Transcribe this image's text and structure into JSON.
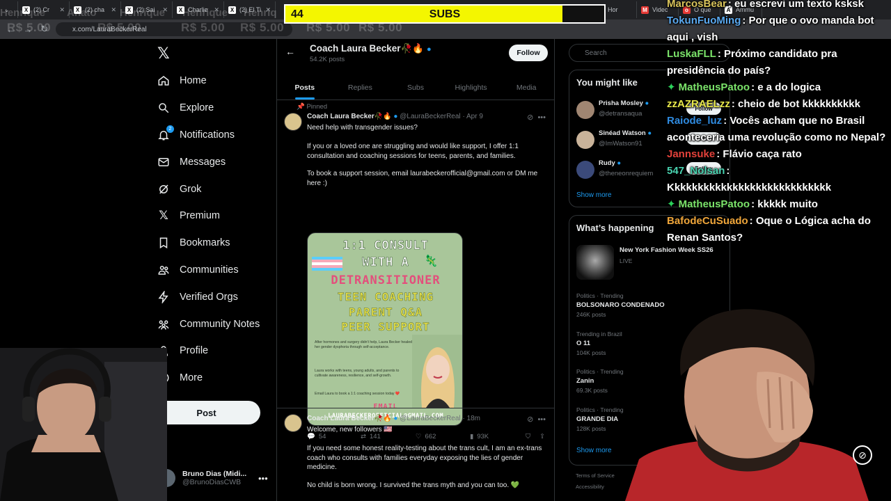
{
  "browser": {
    "tabs": [
      {
        "icon": "X",
        "label": "(2) Cr"
      },
      {
        "icon": "X",
        "label": "(2) cha"
      },
      {
        "icon": "X",
        "label": "(2) Sai"
      },
      {
        "icon": "X",
        "label": "Charlie"
      },
      {
        "icon": "X",
        "label": "(2) El Ti"
      }
    ],
    "tabs_right": [
      {
        "icon": "X",
        "label": "Hor"
      },
      {
        "icon": "M",
        "label": "Videc"
      },
      {
        "icon": "o",
        "label": "O que"
      },
      {
        "icon": "A",
        "label": "Ammu"
      }
    ],
    "url": "x.com/LauraBeckerReal"
  },
  "ghost_text": [
    "R$ 5.00",
    "R$ 5.00",
    "R$ 5.00",
    "R$ 5.00",
    "R$ 5.00",
    "R$ 5.00"
  ],
  "ghost_top": [
    "Henrique",
    "Anato",
    "Henrique",
    "Henrique",
    "Henriq"
  ],
  "subs_goal": {
    "count": "44",
    "label": "SUBS",
    "fill_fraction": 0.87
  },
  "sidebar": {
    "items": [
      {
        "label": "Home",
        "icon": "home-icon"
      },
      {
        "label": "Explore",
        "icon": "search-icon"
      },
      {
        "label": "Notifications",
        "icon": "bell-icon",
        "badge": "2"
      },
      {
        "label": "Messages",
        "icon": "mail-icon"
      },
      {
        "label": "Grok",
        "icon": "grok-icon"
      },
      {
        "label": "Premium",
        "icon": "x-icon"
      },
      {
        "label": "Bookmarks",
        "icon": "bookmark-icon"
      },
      {
        "label": "Communities",
        "icon": "people-icon"
      },
      {
        "label": "Verified Orgs",
        "icon": "bolt-icon"
      },
      {
        "label": "Community Notes",
        "icon": "notes-icon"
      },
      {
        "label": "Profile",
        "icon": "person-icon"
      },
      {
        "label": "More",
        "icon": "more-circle-icon"
      }
    ],
    "post_label": "Post",
    "account": {
      "name": "Bruno Dias (Midi...",
      "handle": "@BrunoDiasCWB"
    }
  },
  "profile": {
    "name": "Coach Laura Becker🥀🔥",
    "posts_count": "54.2K posts",
    "follow_label": "Follow",
    "tabs": [
      "Posts",
      "Replies",
      "Subs",
      "Highlights",
      "Media"
    ]
  },
  "tweets": [
    {
      "pinned": "Pinned",
      "name": "Coach Laura Becker🥀🔥",
      "handle": "@LauraBeckerReal",
      "time": "Apr 9",
      "paragraphs": [
        "Need help with transgender issues?",
        "If you or a loved one are struggling and would like support, I offer 1:1 consultation and coaching sessions for teens, parents, and families.",
        "To book a support session, email laurabeckerofficial@gmail.com or DM me here :)"
      ],
      "image": {
        "lines": [
          "1:1 CONSULT",
          "WITH A",
          "DETRANSITIONER",
          "TEEN COACHING",
          "PARENT Q&A",
          "PEER SUPPORT"
        ],
        "small": [
          "After hormones and surgery didn't help, Laura Becker healed her gender dysphoria through self-acceptance.",
          "Laura works with teens, young adults, and parents to cultivate awareness, resilience, and self-growth.",
          "Email Laura to book a 1:1 coaching session today ❤️"
        ],
        "email_label": "EMAIL",
        "email": "LAURABECKEROFFICIAL@GMAIL.COM"
      },
      "replies": "54",
      "reposts": "141",
      "likes": "662",
      "views": "93K"
    },
    {
      "name": "Coach Laura Becker🥀🔥",
      "handle": "@LauraBeckerReal",
      "time": "18m",
      "paragraphs": [
        "Welcome, new followers 🇺🇸",
        "If you need some honest reality-testing about the trans cult, I am an ex-trans coach who consults with families everyday exposing the lies of gender medicine.",
        "No child is born wrong. I survived the trans myth and you can too. 💚"
      ]
    }
  ],
  "right": {
    "search_placeholder": "Search",
    "might_like_title": "You might like",
    "might_like": [
      {
        "name": "Prisha Mosley",
        "handle": "@detransaqua",
        "btn": "Follow"
      },
      {
        "name": "Sinéad Watson",
        "handle": "@ImWatson91",
        "btn": "Follow"
      },
      {
        "name": "Rudy",
        "handle": "@theneonrequiem",
        "btn": "Follow"
      }
    ],
    "show_more": "Show more",
    "happening_title": "What’s happening",
    "event": {
      "name": "New York Fashion Week SS26",
      "status": "LIVE"
    },
    "trends": [
      {
        "cat": "Politics · Trending",
        "name": "BOLSONARO CONDENADO",
        "count": "246K posts"
      },
      {
        "cat": "Trending in Brazil",
        "name": "O 11",
        "count": "104K posts"
      },
      {
        "cat": "Politics · Trending",
        "name": "Zanin",
        "count": "69.3K posts"
      },
      {
        "cat": "Politics · Trending",
        "name": "GRANDE DIA",
        "count": "128K posts"
      }
    ],
    "show_more_2": "Show more",
    "footer1": "Terms of Service",
    "footer2": "Accessibility"
  },
  "chat": [
    {
      "user": "MarcosBear",
      "color": "#d8c35b",
      "text": "eu escrevi um texto ksksk"
    },
    {
      "user": "TokunFuoMing",
      "color": "#5aa9f0",
      "text": "Por que o ovo manda bot aqui , vish"
    },
    {
      "user": "LuskaFLL",
      "color": "#7be36a",
      "text": "Próximo candidato pra presidência do país?"
    },
    {
      "user": "MatheusPatoo",
      "color": "#7be36a",
      "sub": true,
      "text": "e a do logica"
    },
    {
      "user": "zzAZRAELzz",
      "color": "#e8e84a",
      "text": "cheio de bot kkkkkkkkkk"
    },
    {
      "user": "Raiode_luz",
      "color": "#2f8be0",
      "text": "Vocês acham que no Brasil aconteceria uma revolução como no Nepal?"
    },
    {
      "user": "Jannsuke",
      "color": "#e3413a",
      "text": "Flávio caça rato"
    },
    {
      "user": "547_Nolsan",
      "color": "#49d3b0",
      "text": "Kkkkkkkkkkkkkkkkkkkkkkkkkkkk"
    },
    {
      "user": "MatheusPatoo",
      "color": "#7be36a",
      "sub": true,
      "text": "kkkkk muito"
    },
    {
      "user": "BafodeCuSuado",
      "color": "#f0a63a",
      "text": "Oque o Lógica acha do Renan Santos?"
    }
  ]
}
